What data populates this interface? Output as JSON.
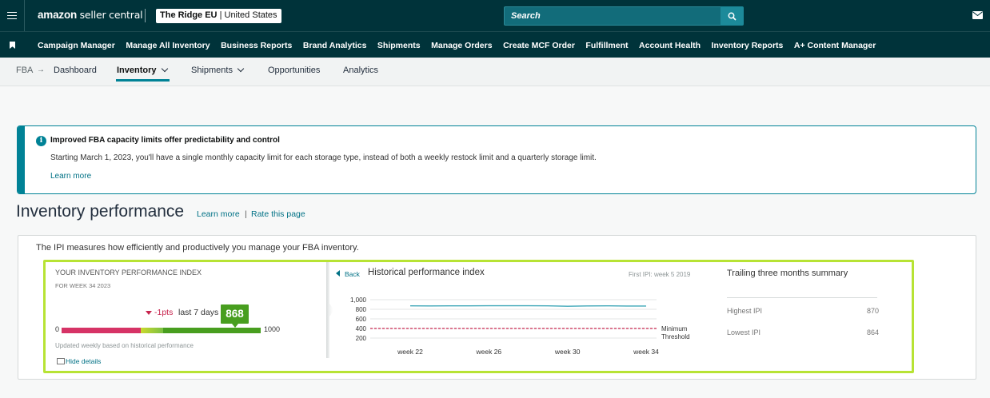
{
  "topbar": {
    "logo_brand": "amazon",
    "logo_product": "seller central",
    "account_store": "The Ridge EU",
    "account_region": "United States",
    "search_placeholder": "Search",
    "icons": [
      "menu-icon",
      "search-icon",
      "mail-icon"
    ]
  },
  "nav": {
    "items": [
      "Campaign Manager",
      "Manage All Inventory",
      "Business Reports",
      "Brand Analytics",
      "Shipments",
      "Manage Orders",
      "Create MCF Order",
      "Fulfillment",
      "Account Health",
      "Inventory Reports",
      "A+ Content Manager"
    ]
  },
  "subnav": {
    "root": "FBA",
    "tabs": [
      "Dashboard",
      "Inventory",
      "Shipments",
      "Opportunities",
      "Analytics"
    ],
    "active": "Inventory"
  },
  "alert": {
    "title": "Improved FBA capacity limits offer predictability and control",
    "body": "Starting March 1, 2023, you'll have a single monthly capacity limit for each storage type, instead of both a weekly restock limit and a quarterly storage limit.",
    "link": "Learn more"
  },
  "performance": {
    "title": "Inventory performance",
    "learn_more": "Learn more",
    "separator": "|",
    "rate": "Rate this page",
    "description": "The IPI measures how efficiently and productively you manage your FBA inventory."
  },
  "ipi": {
    "heading": "YOUR INVENTORY PERFORMANCE INDEX",
    "week": "FOR WEEK 34 2023",
    "change": "-1pts",
    "change_period": "last 7 days",
    "score": "868",
    "min_label": "0",
    "max_label": "1000",
    "score_value": 868,
    "updated": "Updated weekly based on historical performance",
    "hide_details": "Hide details"
  },
  "history": {
    "back": "Back",
    "title": "Historical performance index",
    "first_ipi": "First IPI: week 5 2019",
    "threshold_label_1": "Minimum",
    "threshold_label_2": "Threshold"
  },
  "chart_data": {
    "type": "line",
    "x": [
      "week 22",
      "week 23",
      "week 24",
      "week 25",
      "week 26",
      "week 27",
      "week 28",
      "week 29",
      "week 30",
      "week 31",
      "week 32",
      "week 33",
      "week 34"
    ],
    "x_ticks": [
      "week 22",
      "week 26",
      "week 30",
      "week 34"
    ],
    "series": [
      {
        "values": [
          872,
          870,
          871,
          872,
          874,
          873,
          873,
          872,
          864,
          870,
          871,
          869,
          868
        ],
        "color": "#3fa7b8"
      }
    ],
    "threshold": {
      "value": 400,
      "color": "#c7254e"
    },
    "y_ticks": [
      "1,000",
      "800",
      "600",
      "400",
      "200"
    ],
    "ylim": [
      200,
      1000
    ],
    "grid": true
  },
  "trailing": {
    "title": "Trailing three months summary",
    "rows": [
      {
        "label": "Highest IPI",
        "value": "870"
      },
      {
        "label": "Lowest IPI",
        "value": "864"
      }
    ]
  }
}
